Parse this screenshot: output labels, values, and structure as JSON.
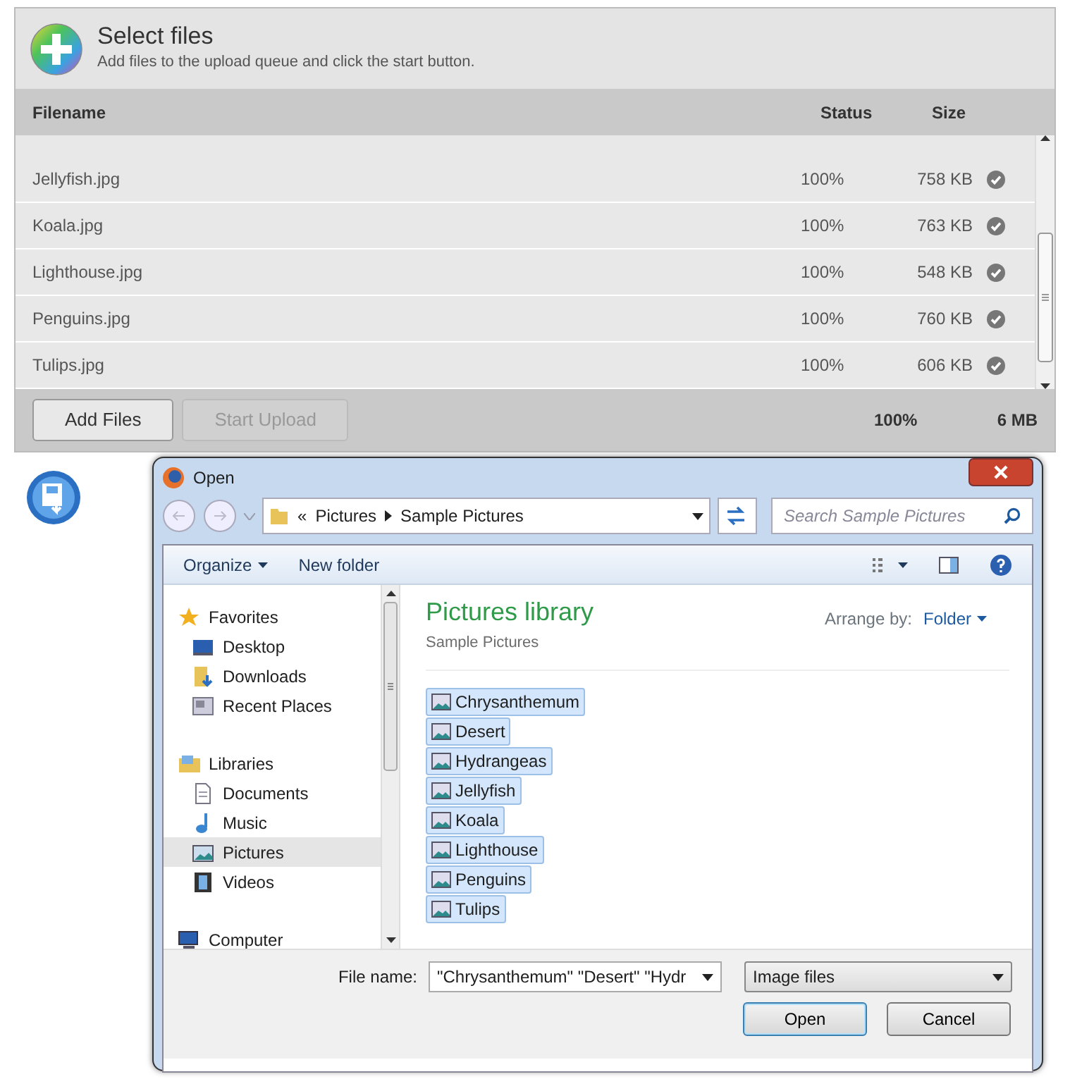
{
  "uploader": {
    "title": "Select files",
    "subtitle": "Add files to the upload queue and click the start button.",
    "columns": [
      "Filename",
      "Status",
      "Size"
    ],
    "rows": [
      {
        "filename": "Jellyfish.jpg",
        "status": "100%",
        "size": "758 KB"
      },
      {
        "filename": "Koala.jpg",
        "status": "100%",
        "size": "763 KB"
      },
      {
        "filename": "Lighthouse.jpg",
        "status": "100%",
        "size": "548 KB"
      },
      {
        "filename": "Penguins.jpg",
        "status": "100%",
        "size": "760 KB"
      },
      {
        "filename": "Tulips.jpg",
        "status": "100%",
        "size": "606 KB"
      }
    ],
    "buttons": [
      {
        "label": "Add Files",
        "disabled": false
      },
      {
        "label": "Start Upload",
        "disabled": true
      }
    ],
    "total_status": "100%",
    "total_size": "6 MB"
  },
  "dialog": {
    "title": "Open",
    "path_prefix": "«",
    "breadcrumb": [
      "Pictures",
      "Sample Pictures"
    ],
    "search_placeholder": "Search Sample Pictures",
    "toolbar": [
      "Organize",
      "New folder"
    ],
    "nav": [
      {
        "label": "Favorites",
        "kind": "star",
        "selected": false,
        "children": [
          {
            "label": "Desktop",
            "kind": "desktop",
            "selected": false
          },
          {
            "label": "Downloads",
            "kind": "downloads",
            "selected": false
          },
          {
            "label": "Recent Places",
            "kind": "recent",
            "selected": false
          }
        ]
      },
      {
        "label": "Libraries",
        "kind": "library",
        "selected": false,
        "children": [
          {
            "label": "Documents",
            "kind": "document",
            "selected": false
          },
          {
            "label": "Music",
            "kind": "music",
            "selected": false
          },
          {
            "label": "Pictures",
            "kind": "pictures",
            "selected": true
          },
          {
            "label": "Videos",
            "kind": "videos",
            "selected": false
          }
        ]
      },
      {
        "label": "Computer",
        "kind": "computer",
        "selected": false
      }
    ],
    "library_title": "Pictures library",
    "library_subtitle": "Sample Pictures",
    "arrange_label": "Arrange by:",
    "arrange_value": "Folder",
    "files": [
      {
        "name": "Chrysanthemum",
        "selected": true
      },
      {
        "name": "Desert",
        "selected": true
      },
      {
        "name": "Hydrangeas",
        "selected": true
      },
      {
        "name": "Jellyfish",
        "selected": true
      },
      {
        "name": "Koala",
        "selected": true
      },
      {
        "name": "Lighthouse",
        "selected": true
      },
      {
        "name": "Penguins",
        "selected": true
      },
      {
        "name": "Tulips",
        "selected": true
      }
    ],
    "filename_label": "File name:",
    "filename_value": "\"Chrysanthemum\" \"Desert\" \"Hydr",
    "filter": "Image files",
    "buttons": [
      "Open",
      "Cancel"
    ]
  }
}
